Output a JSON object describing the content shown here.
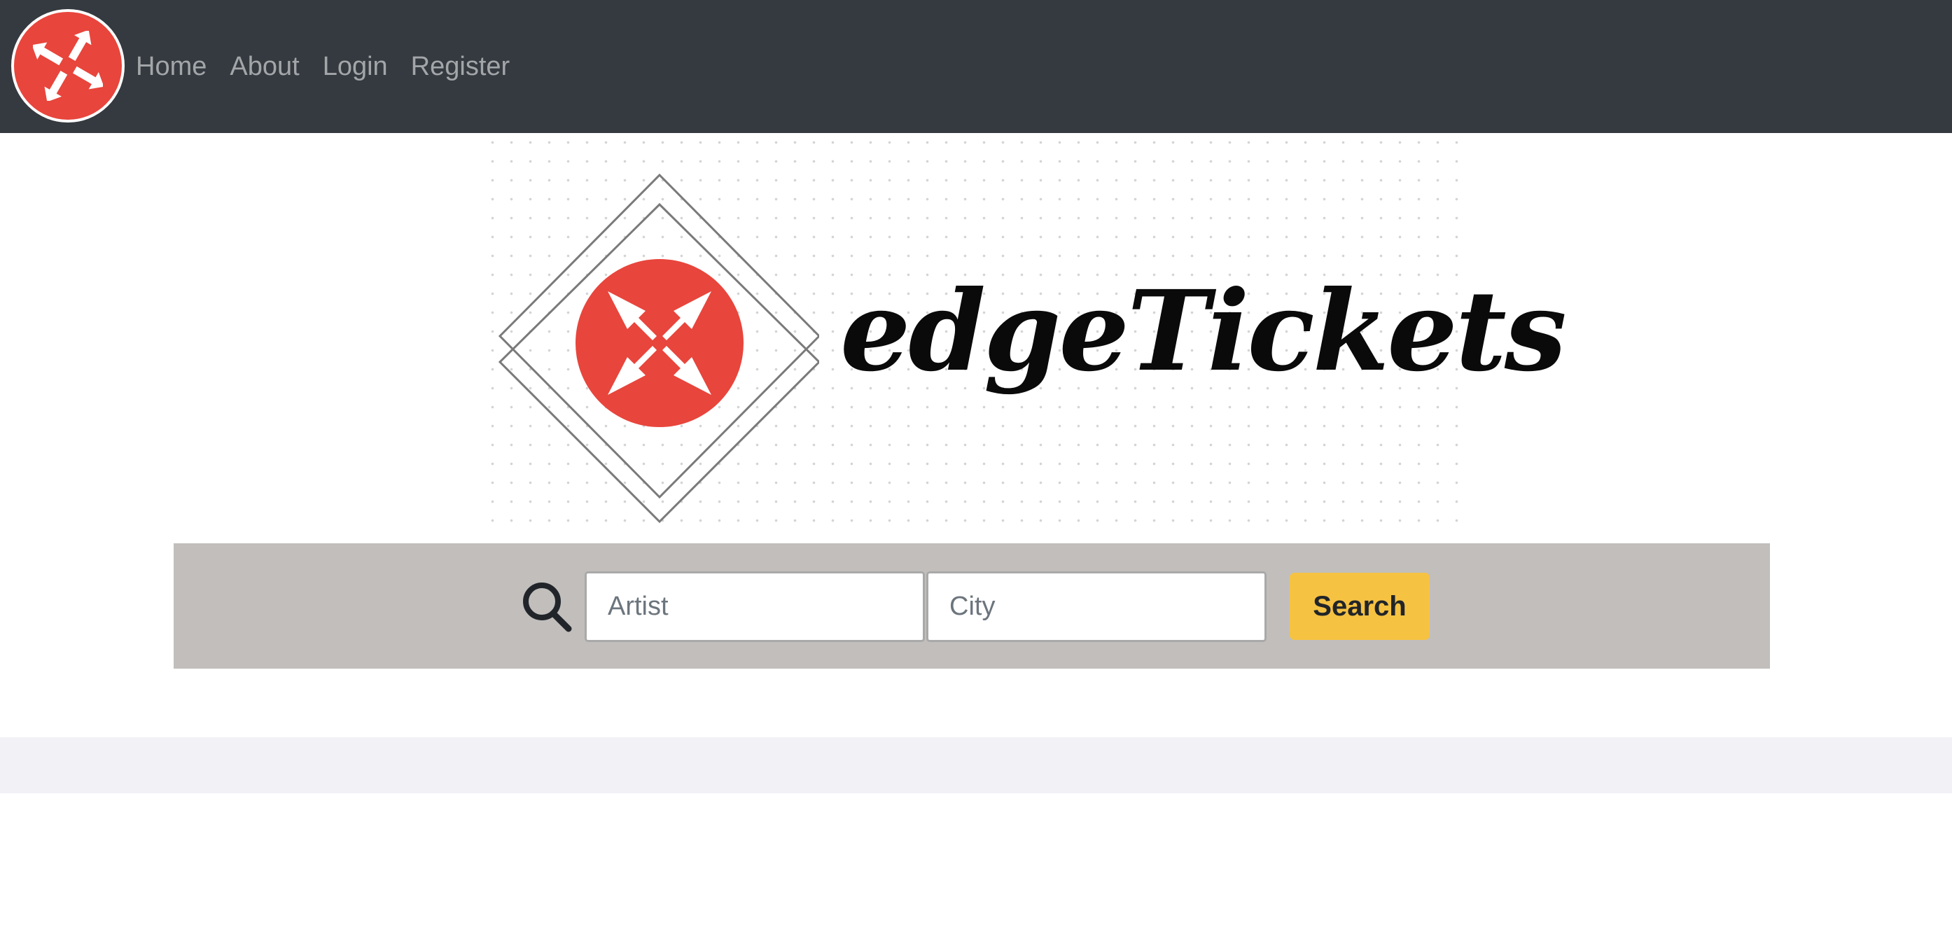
{
  "nav": {
    "logo_icon": "expand-arrows-icon",
    "links": [
      {
        "label": "Home"
      },
      {
        "label": "About"
      },
      {
        "label": "Login"
      },
      {
        "label": "Register"
      }
    ]
  },
  "hero": {
    "brand_name": "edgeTickets",
    "logo_icon": "expand-arrows-icon"
  },
  "search": {
    "icon": "search-icon",
    "artist_placeholder": "Artist",
    "artist_value": "",
    "city_placeholder": "City",
    "city_value": "",
    "button_label": "Search"
  },
  "colors": {
    "navbar": "#343a40",
    "brand_red": "#e8453c",
    "search_band": "#c1bebc",
    "search_button": "#f5c242",
    "footer_band": "#f1f1f6"
  }
}
